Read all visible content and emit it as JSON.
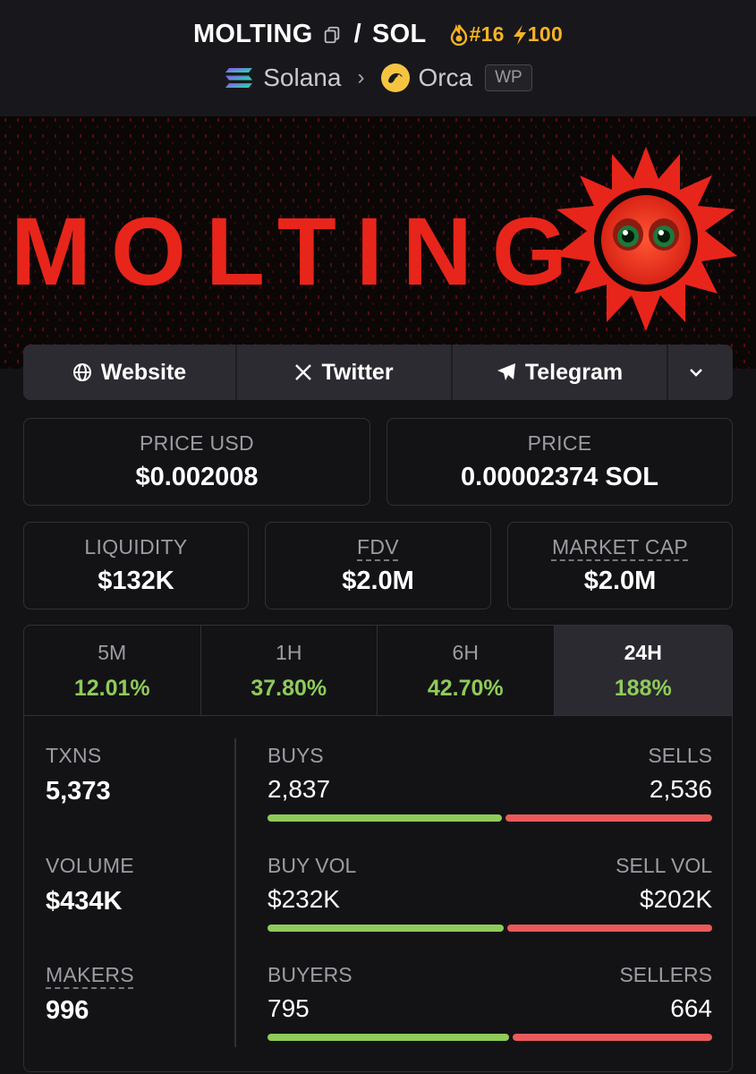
{
  "header": {
    "token": "MOLTING",
    "separator": "/",
    "quote": "SOL",
    "rank": "#16",
    "boost": "100",
    "chain": "Solana",
    "dex": "Orca",
    "wp": "WP"
  },
  "banner": {
    "text": "MOLTING"
  },
  "links": {
    "website": "Website",
    "twitter": "Twitter",
    "telegram": "Telegram"
  },
  "prices": {
    "usd_label": "PRICE USD",
    "usd_value": "$0.002008",
    "native_label": "PRICE",
    "native_value": "0.00002374 SOL"
  },
  "stats": {
    "liquidity_label": "LIQUIDITY",
    "liquidity_value": "$132K",
    "fdv_label": "FDV",
    "fdv_value": "$2.0M",
    "mcap_label": "MARKET CAP",
    "mcap_value": "$2.0M"
  },
  "timeframes": [
    {
      "label": "5M",
      "value": "12.01%"
    },
    {
      "label": "1H",
      "value": "37.80%"
    },
    {
      "label": "6H",
      "value": "42.70%"
    },
    {
      "label": "24H",
      "value": "188%"
    }
  ],
  "metrics": {
    "txns_label": "TXNS",
    "txns_value": "5,373",
    "volume_label": "VOLUME",
    "volume_value": "$434K",
    "makers_label": "MAKERS",
    "makers_value": "996"
  },
  "splits": {
    "buys_label": "BUYS",
    "sells_label": "SELLS",
    "buys_value": "2,837",
    "sells_value": "2,536",
    "buyvol_label": "BUY VOL",
    "sellvol_label": "SELL VOL",
    "buyvol_value": "$232K",
    "sellvol_value": "$202K",
    "buyers_label": "BUYERS",
    "sellers_label": "SELLERS",
    "buyers_value": "795",
    "sellers_value": "664"
  },
  "colors": {
    "positive": "#8fcb5a",
    "negative": "#ea5a5a",
    "boost": "#f6b325",
    "banner_red": "#e8251a"
  }
}
